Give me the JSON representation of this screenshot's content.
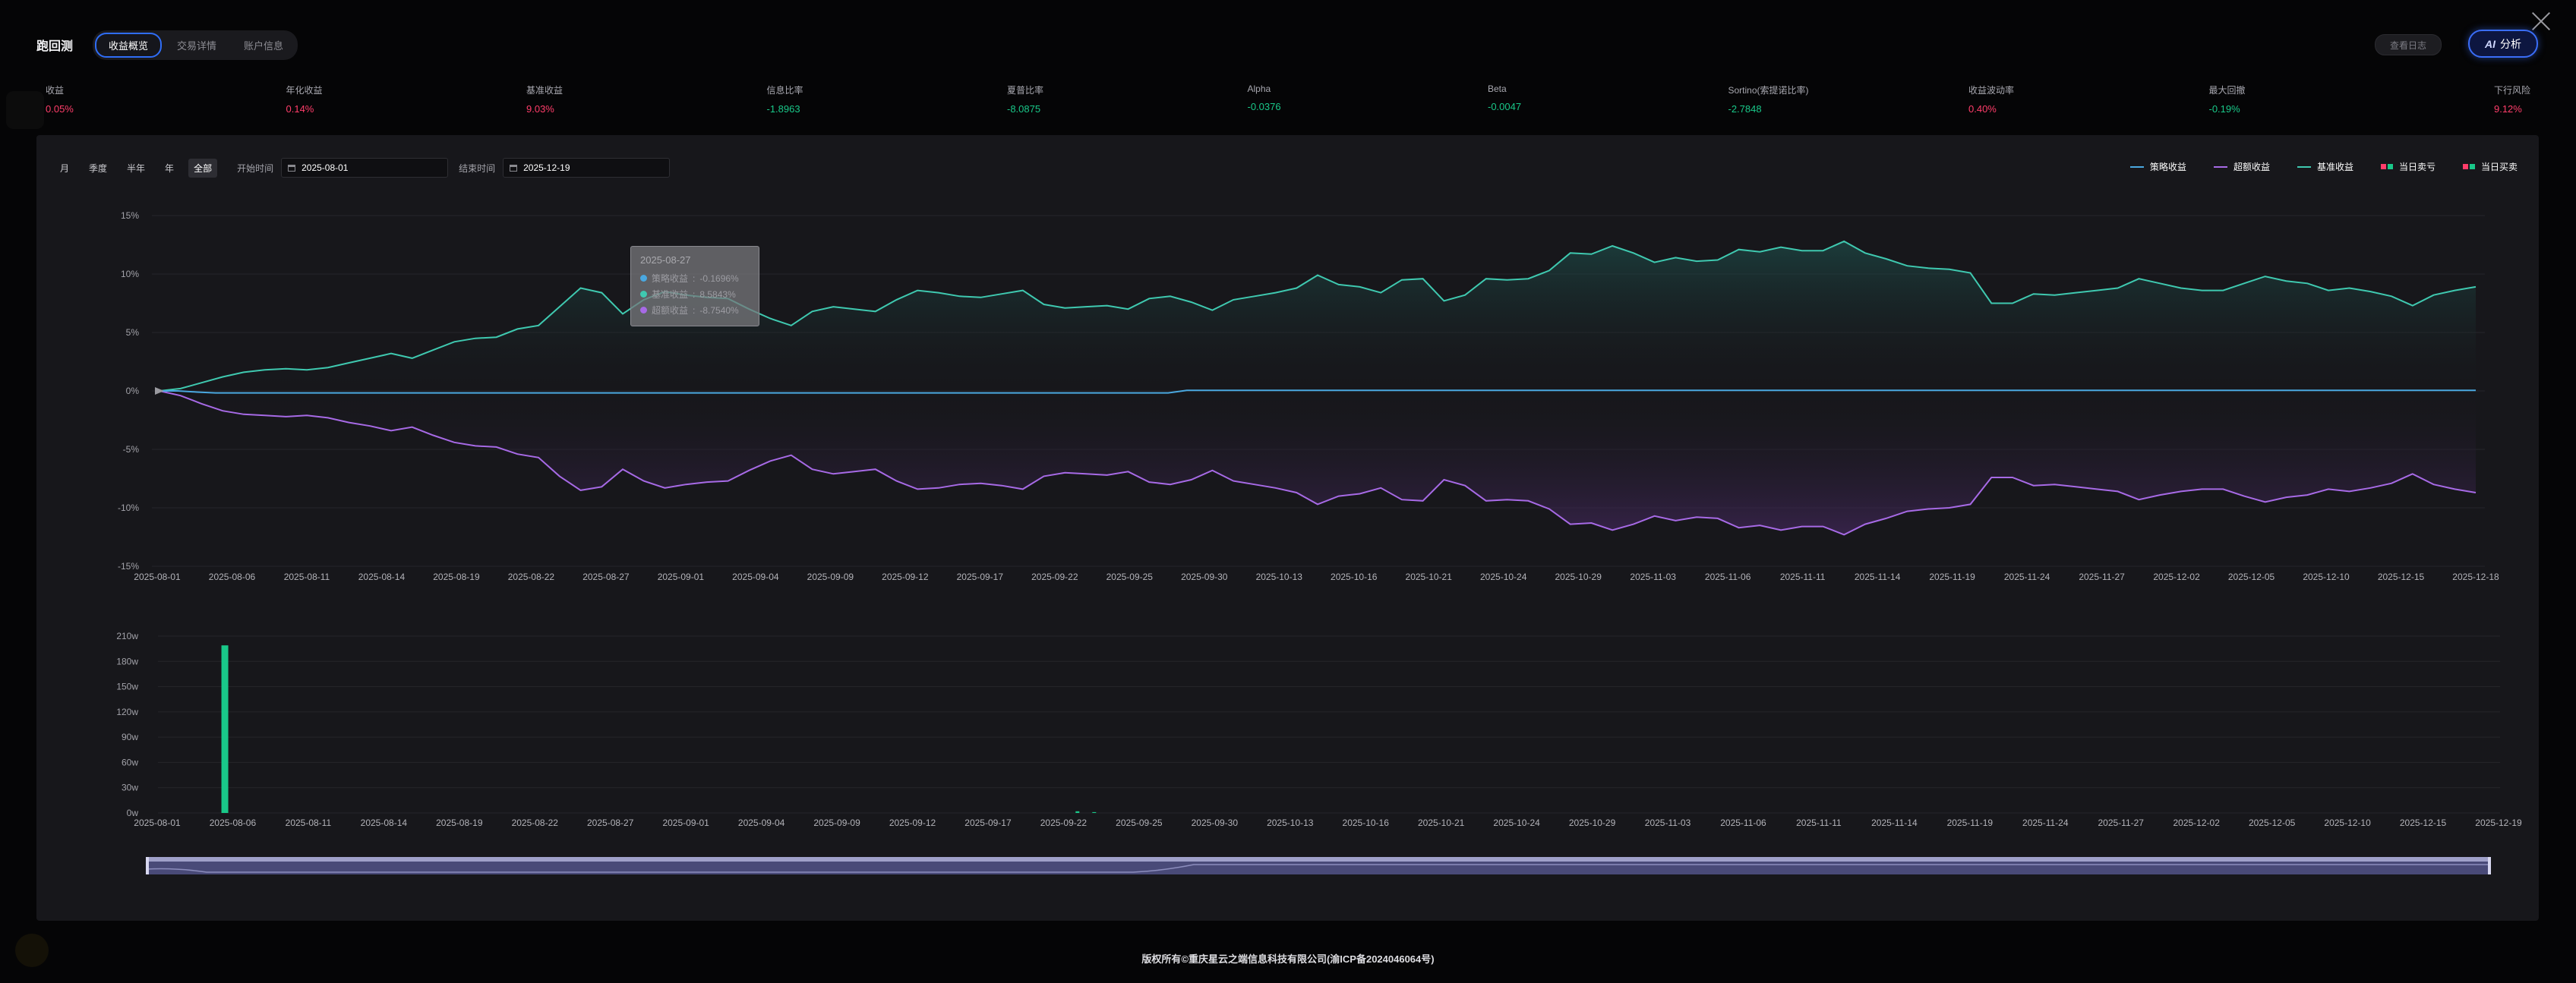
{
  "header": {
    "title": "跑回测",
    "tabs": [
      {
        "label": "收益概览",
        "active": true
      },
      {
        "label": "交易详情",
        "active": false
      },
      {
        "label": "账户信息",
        "active": false
      }
    ],
    "log_button": "查看日志",
    "ai_button": {
      "icon": "AI",
      "label": "分析"
    }
  },
  "metrics": [
    {
      "label": "收益",
      "value": "0.05%",
      "color": "red"
    },
    {
      "label": "年化收益",
      "value": "0.14%",
      "color": "red"
    },
    {
      "label": "基准收益",
      "value": "9.03%",
      "color": "red"
    },
    {
      "label": "信息比率",
      "value": "-1.8963",
      "color": "green"
    },
    {
      "label": "夏普比率",
      "value": "-8.0875",
      "color": "green"
    },
    {
      "label": "Alpha",
      "value": "-0.0376",
      "color": "green"
    },
    {
      "label": "Beta",
      "value": "-0.0047",
      "color": "green"
    },
    {
      "label": "Sortino(索提诺比率)",
      "value": "-2.7848",
      "color": "green"
    },
    {
      "label": "收益波动率",
      "value": "0.40%",
      "color": "red"
    },
    {
      "label": "最大回撤",
      "value": "-0.19%",
      "color": "green"
    },
    {
      "label": "下行风险",
      "value": "9.12%",
      "color": "red"
    }
  ],
  "controls": {
    "periods": [
      {
        "label": "月",
        "active": false
      },
      {
        "label": "季度",
        "active": false
      },
      {
        "label": "半年",
        "active": false
      },
      {
        "label": "年",
        "active": false
      },
      {
        "label": "全部",
        "active": true
      }
    ],
    "start_label": "开始时间",
    "start_value": "2025-08-01",
    "end_label": "结束时间",
    "end_value": "2025-12-19"
  },
  "legend": [
    {
      "label": "策略收益",
      "kind": "line",
      "color": "#4aa8e0"
    },
    {
      "label": "超额收益",
      "kind": "line",
      "color": "#a76ae6"
    },
    {
      "label": "基准收益",
      "kind": "line",
      "color": "#3fc9b0"
    },
    {
      "label": "当日卖亏",
      "kind": "squares",
      "color": "#ff3d6a",
      "color2": "#19c889"
    },
    {
      "label": "当日买卖",
      "kind": "squares",
      "color": "#ff3d6a",
      "color2": "#19c889"
    }
  ],
  "tooltip": {
    "date": "2025-08-27",
    "rows": [
      {
        "label": "策略收益",
        "value": "-0.1696%",
        "color": "#4aa8e0"
      },
      {
        "label": "基准收益",
        "value": "8.5843%",
        "color": "#3fc9b0"
      },
      {
        "label": "超额收益",
        "value": "-8.7540%",
        "color": "#a76ae6"
      }
    ]
  },
  "chart_data": [
    {
      "type": "line",
      "y_unit": "%",
      "ylim": [
        -15,
        15
      ],
      "y_ticks": [
        "15%",
        "10%",
        "5%",
        "0%",
        "-5%",
        "-10%",
        "-15%"
      ],
      "x_tick_labels": [
        "2025-08-01",
        "2025-08-06",
        "2025-08-11",
        "2025-08-14",
        "2025-08-19",
        "2025-08-22",
        "2025-08-27",
        "2025-09-01",
        "2025-09-04",
        "2025-09-09",
        "2025-09-12",
        "2025-09-17",
        "2025-09-22",
        "2025-09-25",
        "2025-09-30",
        "2025-10-13",
        "2025-10-16",
        "2025-10-21",
        "2025-10-24",
        "2025-10-29",
        "2025-11-03",
        "2025-11-06",
        "2025-11-11",
        "2025-11-14",
        "2025-11-19",
        "2025-11-24",
        "2025-11-27",
        "2025-12-02",
        "2025-12-05",
        "2025-12-10",
        "2025-12-15",
        "2025-12-18"
      ],
      "series": [
        {
          "name": "策略收益",
          "color": "#4aa8e0",
          "values": [
            0,
            0,
            -0.1,
            -0.17,
            -0.17,
            -0.17,
            -0.17,
            -0.17,
            -0.17,
            -0.17,
            -0.17,
            -0.17,
            -0.17,
            -0.17,
            -0.17,
            -0.17,
            -0.17,
            -0.17,
            -0.17,
            -0.17,
            -0.17,
            -0.17,
            -0.17,
            -0.17,
            -0.17,
            -0.17,
            -0.17,
            -0.17,
            -0.17,
            -0.17,
            -0.17,
            -0.17,
            -0.17,
            -0.17,
            -0.17,
            -0.17,
            -0.17,
            -0.17,
            -0.17,
            -0.17,
            -0.17,
            -0.17,
            -0.17,
            -0.17,
            -0.17,
            -0.17,
            -0.17,
            -0.17,
            -0.17,
            -0.17,
            -0.17,
            -0.17,
            -0.17,
            -0.17,
            -0.17,
            0.05,
            0.05,
            0.05,
            0.05,
            0.05,
            0.05,
            0.05,
            0.05,
            0.05,
            0.05,
            0.05,
            0.05,
            0.05,
            0.05,
            0.05,
            0.05,
            0.05,
            0.05,
            0.05,
            0.05,
            0.05,
            0.05,
            0.05,
            0.05,
            0.05,
            0.05,
            0.05,
            0.05,
            0.05,
            0.05,
            0.05,
            0.05,
            0.05,
            0.05,
            0.05,
            0.05,
            0.05,
            0.05,
            0.05,
            0.05,
            0.05,
            0.05,
            0.05,
            0.05,
            0.05,
            0.05,
            0.05,
            0.05,
            0.05,
            0.05,
            0.05,
            0.05,
            0.05,
            0.05,
            0.05,
            0.05,
            0.05,
            0.05,
            0.05,
            0.05,
            0.05,
            0.05,
            0.05,
            0.05,
            0.05,
            0.05,
            0.05,
            0.05,
            0.05,
            0.05
          ]
        },
        {
          "name": "基准收益",
          "color": "#3fc9b0",
          "values": [
            0,
            0.2,
            0.7,
            1.2,
            1.6,
            1.8,
            1.9,
            1.8,
            2.0,
            2.4,
            2.8,
            3.2,
            2.8,
            3.5,
            4.2,
            4.5,
            4.6,
            5.3,
            5.6,
            7.2,
            8.8,
            8.4,
            6.6,
            7.8,
            8.5,
            8.2,
            8.0,
            7.9,
            7.0,
            6.2,
            5.6,
            6.8,
            7.2,
            7.0,
            6.8,
            7.8,
            8.6,
            8.4,
            8.1,
            8.0,
            8.3,
            8.6,
            7.4,
            7.1,
            7.2,
            7.3,
            7.0,
            7.9,
            8.1,
            7.6,
            6.9,
            7.8,
            8.1,
            8.4,
            8.8,
            9.9,
            9.1,
            8.9,
            8.4,
            9.5,
            9.6,
            7.7,
            8.2,
            9.6,
            9.5,
            9.6,
            10.3,
            11.8,
            11.7,
            12.4,
            11.8,
            11.0,
            11.4,
            11.1,
            11.2,
            12.1,
            11.9,
            12.3,
            12.0,
            12.0,
            12.8,
            11.8,
            11.3,
            10.7,
            10.5,
            10.4,
            10.1,
            7.5,
            7.5,
            8.3,
            8.2,
            8.4,
            8.6,
            8.8,
            9.6,
            9.2,
            8.8,
            8.6,
            8.6,
            9.2,
            9.8,
            9.4,
            9.2,
            8.6,
            8.8,
            8.5,
            8.1,
            7.3,
            8.2,
            8.6,
            8.9
          ]
        },
        {
          "name": "超额收益",
          "color": "#a76ae6",
          "values": [
            0,
            -0.4,
            -1.1,
            -1.7,
            -2.0,
            -2.1,
            -2.2,
            -2.1,
            -2.3,
            -2.7,
            -3.0,
            -3.4,
            -3.1,
            -3.8,
            -4.4,
            -4.7,
            -4.8,
            -5.4,
            -5.7,
            -7.3,
            -8.5,
            -8.2,
            -6.7,
            -7.7,
            -8.3,
            -8.0,
            -7.8,
            -7.7,
            -6.8,
            -6.0,
            -5.5,
            -6.7,
            -7.1,
            -6.9,
            -6.7,
            -7.7,
            -8.4,
            -8.3,
            -8.0,
            -7.9,
            -8.1,
            -8.4,
            -7.3,
            -7.0,
            -7.1,
            -7.2,
            -6.9,
            -7.8,
            -8.0,
            -7.6,
            -6.8,
            -7.7,
            -8.0,
            -8.3,
            -8.7,
            -9.7,
            -9.0,
            -8.8,
            -8.3,
            -9.3,
            -9.4,
            -7.6,
            -8.1,
            -9.4,
            -9.3,
            -9.4,
            -10.1,
            -11.4,
            -11.3,
            -11.9,
            -11.4,
            -10.7,
            -11.1,
            -10.8,
            -10.9,
            -11.7,
            -11.5,
            -11.9,
            -11.6,
            -11.6,
            -12.3,
            -11.4,
            -10.9,
            -10.3,
            -10.1,
            -10.0,
            -9.7,
            -7.4,
            -7.4,
            -8.1,
            -8.0,
            -8.2,
            -8.4,
            -8.6,
            -9.3,
            -8.9,
            -8.6,
            -8.4,
            -8.4,
            -9.0,
            -9.5,
            -9.1,
            -8.9,
            -8.4,
            -8.6,
            -8.3,
            -7.9,
            -7.1,
            -8.0,
            -8.4,
            -8.7
          ]
        }
      ]
    },
    {
      "type": "bar",
      "y_unit": "w",
      "ylim": [
        0,
        210
      ],
      "y_ticks": [
        "210w",
        "180w",
        "150w",
        "120w",
        "90w",
        "60w",
        "30w",
        "0w"
      ],
      "x_tick_labels": [
        "2025-08-01",
        "2025-08-06",
        "2025-08-11",
        "2025-08-14",
        "2025-08-19",
        "2025-08-22",
        "2025-08-27",
        "2025-09-01",
        "2025-09-04",
        "2025-09-09",
        "2025-09-12",
        "2025-09-17",
        "2025-09-22",
        "2025-09-25",
        "2025-09-30",
        "2025-10-13",
        "2025-10-16",
        "2025-10-21",
        "2025-10-24",
        "2025-10-29",
        "2025-11-03",
        "2025-11-06",
        "2025-11-11",
        "2025-11-14",
        "2025-11-19",
        "2025-11-24",
        "2025-11-27",
        "2025-12-02",
        "2025-12-05",
        "2025-12-10",
        "2025-12-15",
        "2025-12-19"
      ],
      "bars": [
        {
          "date": "2025-08-05",
          "value": 199,
          "color": "#19c889"
        },
        {
          "date": "2025-09-25",
          "value": 2,
          "color": "#19c889"
        },
        {
          "date": "2025-09-26",
          "value": 1,
          "color": "#19c889"
        }
      ]
    }
  ],
  "footer": "版权所有©重庆星云之端信息科技有限公司(渝ICP备2024046064号)"
}
